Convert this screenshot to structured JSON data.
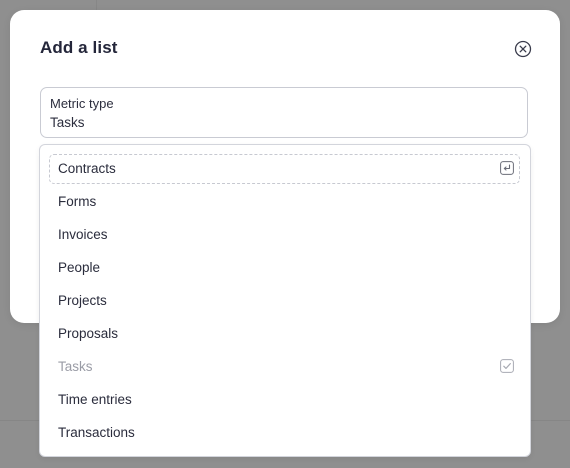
{
  "modal": {
    "title": "Add a list",
    "close_icon": "close-circle-icon"
  },
  "select": {
    "label": "Metric type",
    "value": "Tasks"
  },
  "dropdown": {
    "options": [
      {
        "label": "Contracts",
        "state": "highlighted",
        "icon": "enter-key-icon"
      },
      {
        "label": "Forms"
      },
      {
        "label": "Invoices"
      },
      {
        "label": "People"
      },
      {
        "label": "Projects"
      },
      {
        "label": "Proposals"
      },
      {
        "label": "Tasks",
        "state": "selected-disabled",
        "icon": "checkbox-checked-icon"
      },
      {
        "label": "Time entries"
      },
      {
        "label": "Transactions"
      }
    ]
  },
  "colors": {
    "overlay": "#8e8e8e",
    "title": "#24263a",
    "text": "#2a2c3c",
    "muted": "#9a9ca6",
    "border": "#c9cbd3"
  }
}
